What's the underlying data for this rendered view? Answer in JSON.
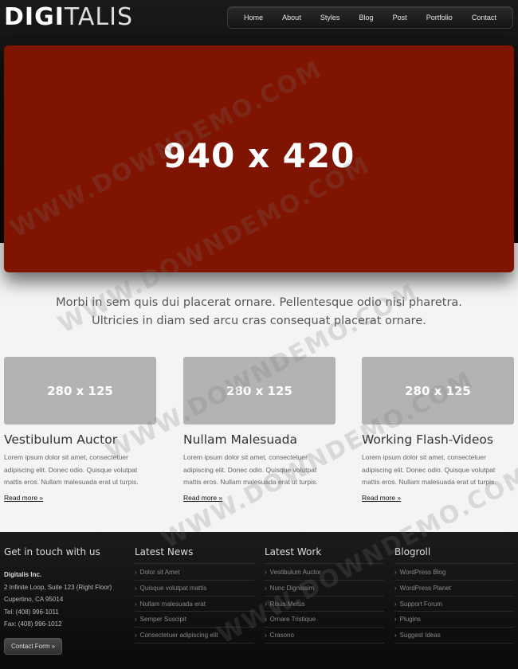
{
  "logo": {
    "bold": "DIGI",
    "rest": "TALIS"
  },
  "nav": [
    "Home",
    "About",
    "Styles",
    "Blog",
    "Post",
    "Portfolio",
    "Contact"
  ],
  "slider": {
    "text": "940 x 420",
    "color": "#7f1400"
  },
  "intro": {
    "line1": "Morbi in sem quis dui placerat ornare. Pellentesque odio nisi pharetra.",
    "line2": "Ultricies in diam sed arcu cras consequat placerat ornare."
  },
  "columns": [
    {
      "thumb": "280 x 125",
      "title": "Vestibulum Auctor",
      "text": "Lorem ipsum dolor sit amet, consectetuer adipiscing elit. Donec odio. Quisque volutpat mattis eros. Nullam malesuada erat ut turpis.",
      "more": "Read more »"
    },
    {
      "thumb": "280 x 125",
      "title": "Nullam Malesuada",
      "text": "Lorem ipsum dolor sit amet, consectetuer adipiscing elit. Donec odio. Quisque volutpat mattis eros. Nullam malesuada erat ut turpis.",
      "more": "Read more »"
    },
    {
      "thumb": "280 x 125",
      "title": "Working Flash-Videos",
      "text": "Lorem ipsum dolor sit amet, consectetuer adipiscing elit. Donec odio. Quisque volutpat mattis eros. Nullam malesuada erat ut turpis.",
      "more": "Read more »"
    }
  ],
  "footer": {
    "contact": {
      "heading": "Get in touch with us",
      "company": "Digitalis Inc.",
      "address1": "2 Infinite Loop, Suite 123 (Right Floor)",
      "address2": "Cupertino, CA 95014",
      "tel": "Tel: (408) 996-1011",
      "fax": "Fax: (408) 996-1012",
      "button": "Contact Form »"
    },
    "news": {
      "heading": "Latest News",
      "items": [
        "Dolor sit Amet",
        "Quisque volutpat mattis",
        "Nullam malesuada erat",
        "Semper Suscipit",
        "Consectetuer adipiscing elit"
      ]
    },
    "work": {
      "heading": "Latest Work",
      "items": [
        "Vestibulum Auctor",
        "Nunc Dignissim",
        "Risus Metus",
        "Ornare Tristique",
        "Crasono"
      ]
    },
    "blogroll": {
      "heading": "Blogroll",
      "items": [
        "WordPress Blog",
        "WordPress Planet",
        "Support Forum",
        "Plugins",
        "Suggest Ideas"
      ]
    }
  },
  "watermark": "WWW.DOWNDEMO.COM"
}
